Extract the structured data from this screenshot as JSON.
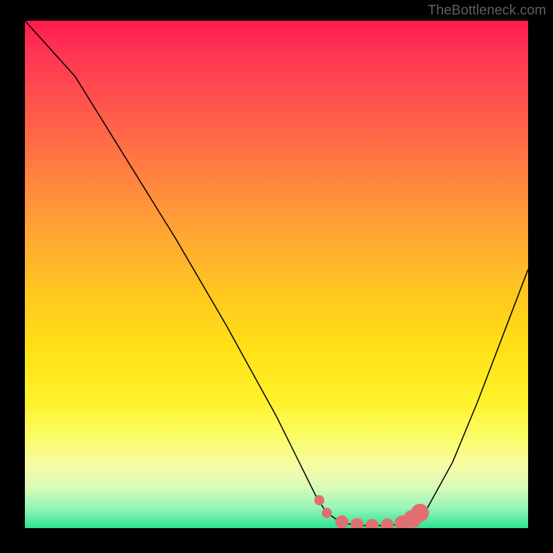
{
  "attribution": "TheBottleneck.com",
  "chart_data": {
    "type": "line",
    "title": "",
    "xlabel": "",
    "ylabel": "",
    "xlim": [
      0,
      100
    ],
    "ylim": [
      0,
      100
    ],
    "series": [
      {
        "name": "bottleneck-curve",
        "color": "#000000",
        "points": [
          {
            "x": 0,
            "y": 100
          },
          {
            "x": 10,
            "y": 89
          },
          {
            "x": 20,
            "y": 73
          },
          {
            "x": 30,
            "y": 57
          },
          {
            "x": 40,
            "y": 40
          },
          {
            "x": 50,
            "y": 22
          },
          {
            "x": 55,
            "y": 12
          },
          {
            "x": 58,
            "y": 6
          },
          {
            "x": 60,
            "y": 3
          },
          {
            "x": 63,
            "y": 1
          },
          {
            "x": 67,
            "y": 0.5
          },
          {
            "x": 72,
            "y": 0.5
          },
          {
            "x": 76,
            "y": 1
          },
          {
            "x": 80,
            "y": 4
          },
          {
            "x": 85,
            "y": 13
          },
          {
            "x": 90,
            "y": 25
          },
          {
            "x": 95,
            "y": 38
          },
          {
            "x": 100,
            "y": 51
          }
        ]
      },
      {
        "name": "optimal-zone-markers",
        "color": "#e07070",
        "points": [
          {
            "x": 58.5,
            "y": 5.5,
            "r": 1.0
          },
          {
            "x": 60,
            "y": 3,
            "r": 1.0
          },
          {
            "x": 63,
            "y": 1.2,
            "r": 1.3
          },
          {
            "x": 66,
            "y": 0.7,
            "r": 1.3
          },
          {
            "x": 69,
            "y": 0.5,
            "r": 1.3
          },
          {
            "x": 72,
            "y": 0.6,
            "r": 1.3
          },
          {
            "x": 75,
            "y": 1.0,
            "r": 1.5
          },
          {
            "x": 77,
            "y": 1.8,
            "r": 1.8
          },
          {
            "x": 78.5,
            "y": 3.0,
            "r": 1.8
          }
        ]
      }
    ],
    "background_gradient": {
      "top": "#ff1a4d",
      "mid": "#ffe116",
      "bottom": "#2de38f"
    }
  }
}
